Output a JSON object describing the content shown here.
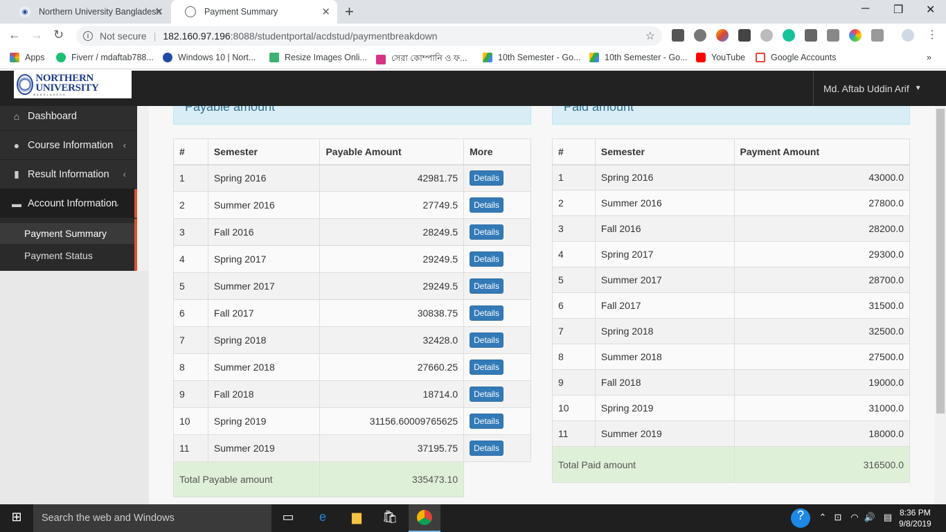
{
  "browser": {
    "tabs": [
      {
        "title": "Northern University Bangladesh"
      },
      {
        "title": "Payment Summary"
      }
    ],
    "address": {
      "security": "Not secure",
      "host": "182.160.97.196",
      "path": ":8088/studentportal/acdstud/paymentbreakdown"
    },
    "bookmarks": [
      {
        "label": "Apps"
      },
      {
        "label": "Fiverr / mdaftab788..."
      },
      {
        "label": "Windows 10 | Nort..."
      },
      {
        "label": "Resize Images Onli..."
      },
      {
        "label": "সেরা কোম্পানি ও ফ..."
      },
      {
        "label": "10th Semester - Go..."
      },
      {
        "label": "10th Semester - Go..."
      },
      {
        "label": "YouTube"
      },
      {
        "label": "Google Accounts"
      }
    ]
  },
  "header": {
    "logo_text": "NORTHERN UNIVERSITY",
    "logo_sub": "BANGLADESH",
    "user_name": "Md. Aftab Uddin Arif"
  },
  "sidebar": {
    "items": [
      {
        "label": "Dashboard"
      },
      {
        "label": "Course Information"
      },
      {
        "label": "Result Information"
      },
      {
        "label": "Account Information"
      }
    ],
    "subitems": [
      {
        "label": "Payment Summary"
      },
      {
        "label": "Payment Status"
      }
    ]
  },
  "payable": {
    "heading": "Payable amount",
    "columns": [
      "#",
      "Semester",
      "Payable Amount",
      "More"
    ],
    "button_label": "Details",
    "rows": [
      {
        "n": "1",
        "semester": "Spring 2016",
        "amount": "42981.75"
      },
      {
        "n": "2",
        "semester": "Summer 2016",
        "amount": "27749.5"
      },
      {
        "n": "3",
        "semester": "Fall 2016",
        "amount": "28249.5"
      },
      {
        "n": "4",
        "semester": "Spring 2017",
        "amount": "29249.5"
      },
      {
        "n": "5",
        "semester": "Summer 2017",
        "amount": "29249.5"
      },
      {
        "n": "6",
        "semester": "Fall 2017",
        "amount": "30838.75"
      },
      {
        "n": "7",
        "semester": "Spring 2018",
        "amount": "32428.0"
      },
      {
        "n": "8",
        "semester": "Summer 2018",
        "amount": "27660.25"
      },
      {
        "n": "9",
        "semester": "Fall 2018",
        "amount": "18714.0"
      },
      {
        "n": "10",
        "semester": "Spring 2019",
        "amount": "31156.60009765625"
      },
      {
        "n": "11",
        "semester": "Summer 2019",
        "amount": "37195.75"
      }
    ],
    "total_label": "Total Payable amount",
    "total_value": "335473.10"
  },
  "paid": {
    "heading": "Paid amount",
    "columns": [
      "#",
      "Semester",
      "Payment Amount"
    ],
    "rows": [
      {
        "n": "1",
        "semester": "Spring 2016",
        "amount": "43000.0"
      },
      {
        "n": "2",
        "semester": "Summer 2016",
        "amount": "27800.0"
      },
      {
        "n": "3",
        "semester": "Fall 2016",
        "amount": "28200.0"
      },
      {
        "n": "4",
        "semester": "Spring 2017",
        "amount": "29300.0"
      },
      {
        "n": "5",
        "semester": "Summer 2017",
        "amount": "28700.0"
      },
      {
        "n": "6",
        "semester": "Fall 2017",
        "amount": "31500.0"
      },
      {
        "n": "7",
        "semester": "Spring 2018",
        "amount": "32500.0"
      },
      {
        "n": "8",
        "semester": "Summer 2018",
        "amount": "27500.0"
      },
      {
        "n": "9",
        "semester": "Fall 2018",
        "amount": "19000.0"
      },
      {
        "n": "10",
        "semester": "Spring 2019",
        "amount": "31000.0"
      },
      {
        "n": "11",
        "semester": "Summer 2019",
        "amount": "18000.0"
      }
    ],
    "total_label": "Total Paid amount",
    "total_value": "316500.0"
  },
  "taskbar": {
    "search_placeholder": "Search the web and Windows",
    "time": "8:36 PM",
    "date": "9/8/2019"
  },
  "colors": {
    "accent": "#e0522f",
    "button": "#337ab7",
    "info_panel": "#d9edf7",
    "total_row": "#dff0d8"
  }
}
